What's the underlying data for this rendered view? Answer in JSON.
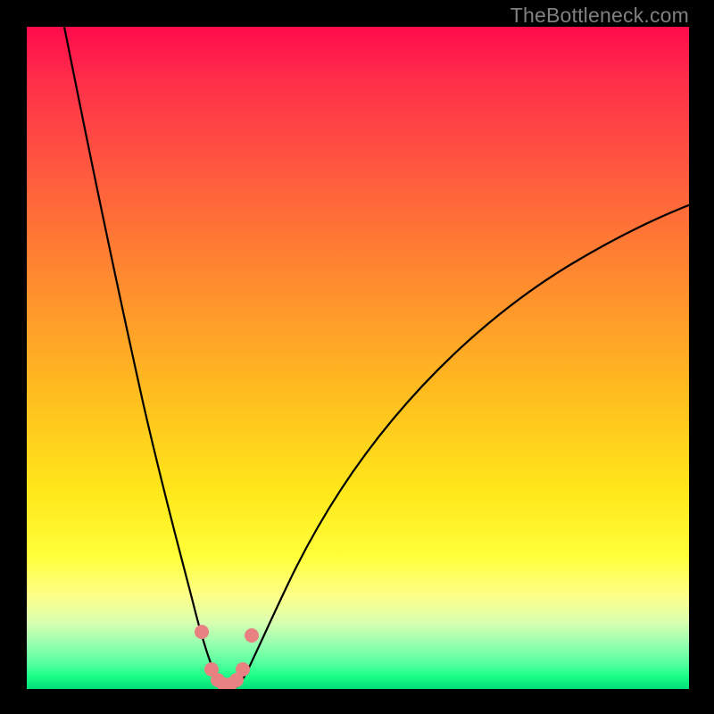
{
  "watermark": "TheBottleneck.com",
  "chart_data": {
    "type": "line",
    "title": "",
    "xlabel": "",
    "ylabel": "",
    "xlim": [
      0,
      100
    ],
    "ylim": [
      0,
      100
    ],
    "series": [
      {
        "name": "left-curve",
        "x": [
          4,
          6,
          8,
          10,
          12,
          14,
          16,
          18,
          20,
          22,
          24,
          25,
          26,
          27,
          28,
          29
        ],
        "y": [
          100,
          87,
          75,
          64,
          54,
          45,
          37,
          30,
          23,
          17,
          11,
          8,
          6,
          4,
          2.5,
          1.5
        ]
      },
      {
        "name": "right-curve",
        "x": [
          31,
          32,
          33,
          34,
          36,
          38,
          40,
          44,
          48,
          54,
          60,
          68,
          76,
          84,
          92,
          100
        ],
        "y": [
          1.5,
          2.5,
          4,
          6,
          9,
          13,
          17,
          24,
          31,
          39,
          46,
          54,
          60,
          65,
          70,
          74
        ]
      }
    ],
    "highlight_points": {
      "name": "marker-dots",
      "x": [
        25.5,
        27.2,
        28.3,
        29.2,
        30.0,
        30.8,
        31.6,
        32.8
      ],
      "y": [
        8.0,
        2.2,
        1.1,
        0.9,
        0.9,
        1.1,
        2.2,
        8.0
      ]
    },
    "background_gradient": {
      "top": "#ff0a4b",
      "mid": "#ffe71a",
      "bottom": "#00dd77"
    }
  }
}
